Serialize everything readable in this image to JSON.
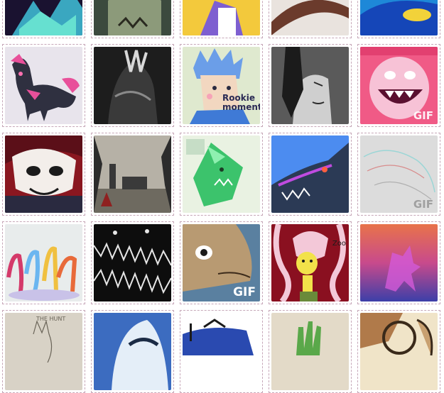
{
  "gallery": {
    "items": [
      {
        "kind": "image",
        "overlay": ""
      },
      {
        "kind": "image",
        "overlay": ""
      },
      {
        "kind": "image",
        "overlay": ""
      },
      {
        "kind": "image",
        "overlay": ""
      },
      {
        "kind": "image",
        "overlay": ""
      },
      {
        "kind": "image",
        "overlay": ""
      },
      {
        "kind": "image",
        "overlay": ""
      },
      {
        "kind": "image",
        "overlay": "Rookie moment."
      },
      {
        "kind": "image",
        "overlay": ""
      },
      {
        "kind": "gif",
        "overlay": "GIF"
      },
      {
        "kind": "image",
        "overlay": ""
      },
      {
        "kind": "image",
        "overlay": ""
      },
      {
        "kind": "image",
        "overlay": ""
      },
      {
        "kind": "image",
        "overlay": ""
      },
      {
        "kind": "gif",
        "overlay": "GIF"
      },
      {
        "kind": "image",
        "overlay": ""
      },
      {
        "kind": "image",
        "overlay": ""
      },
      {
        "kind": "gif",
        "overlay": "GIF"
      },
      {
        "kind": "image",
        "overlay": "Zoo"
      },
      {
        "kind": "image",
        "overlay": ""
      },
      {
        "kind": "image",
        "overlay": "THE HUNT"
      },
      {
        "kind": "image",
        "overlay": ""
      },
      {
        "kind": "image",
        "overlay": ""
      },
      {
        "kind": "image",
        "overlay": ""
      },
      {
        "kind": "image",
        "overlay": ""
      }
    ]
  },
  "colors": {
    "cell_border": "#c6a7b8",
    "page_bg": "#ffffff"
  }
}
